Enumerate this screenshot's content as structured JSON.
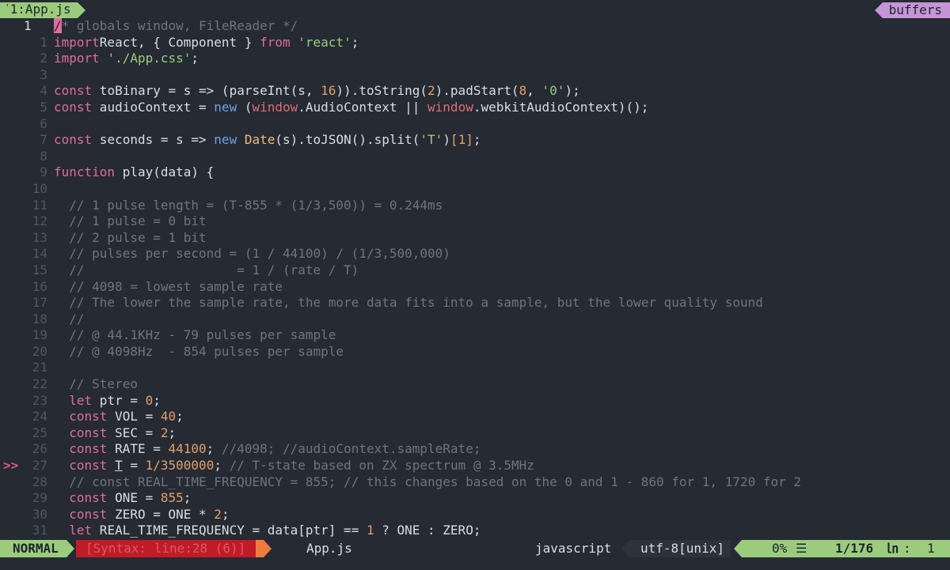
{
  "tabline": {
    "modified_mark": "'",
    "active_tab": "1:App.js",
    "buffers_label": "buffers"
  },
  "editor": {
    "lines": [
      {
        "sign": "",
        "num": "1",
        "current": true,
        "tokens": [
          [
            "cursor",
            "/"
          ],
          [
            "cmt",
            "* globals window, FileReader */"
          ]
        ]
      },
      {
        "sign": "",
        "num": "1",
        "tokens": [
          [
            "kw",
            "import"
          ],
          [
            "",
            "React, { Component } "
          ],
          [
            "kw",
            "from"
          ],
          [
            "",
            " "
          ],
          [
            "str",
            "'react'"
          ],
          [
            "",
            ";"
          ]
        ]
      },
      {
        "sign": "",
        "num": "2",
        "tokens": [
          [
            "kw",
            "import"
          ],
          [
            "",
            " "
          ],
          [
            "str",
            "'./App.css'"
          ],
          [
            "",
            ";"
          ]
        ]
      },
      {
        "sign": "",
        "num": "3",
        "tokens": []
      },
      {
        "sign": "",
        "num": "4",
        "tokens": [
          [
            "kw",
            "const"
          ],
          [
            "",
            " toBinary = s => (parseInt(s, "
          ],
          [
            "num",
            "16"
          ],
          [
            "",
            "))"
          ],
          [
            "",
            ".toString("
          ],
          [
            "num",
            "2"
          ],
          [
            "",
            ").padStart("
          ],
          [
            "num",
            "8"
          ],
          [
            "",
            ", "
          ],
          [
            "str",
            "'0'"
          ],
          [
            "",
            ");"
          ]
        ]
      },
      {
        "sign": "",
        "num": "5",
        "tokens": [
          [
            "kw",
            "const"
          ],
          [
            "",
            " audioContext = "
          ],
          [
            "blue",
            "new"
          ],
          [
            "",
            " ("
          ],
          [
            "red",
            "window"
          ],
          [
            "",
            ".AudioContext || "
          ],
          [
            "red",
            "window"
          ],
          [
            "",
            ".webkitAudioContext)();"
          ]
        ]
      },
      {
        "sign": "",
        "num": "6",
        "tokens": []
      },
      {
        "sign": "",
        "num": "7",
        "tokens": [
          [
            "kw",
            "const"
          ],
          [
            "",
            " seconds = s => "
          ],
          [
            "blue",
            "new"
          ],
          [
            "",
            " "
          ],
          [
            "yel",
            "Date"
          ],
          [
            "",
            "(s).toJSON().split("
          ],
          [
            "str",
            "'T'"
          ],
          [
            "",
            ")"
          ],
          [
            "num",
            "[1]"
          ],
          [
            "",
            ";"
          ]
        ]
      },
      {
        "sign": "",
        "num": "8",
        "tokens": []
      },
      {
        "sign": "",
        "num": "9",
        "tokens": [
          [
            "kw",
            "function"
          ],
          [
            "",
            " play(data) {"
          ]
        ]
      },
      {
        "sign": "",
        "num": "10",
        "tokens": []
      },
      {
        "sign": "",
        "num": "11",
        "tokens": [
          [
            "",
            "  "
          ],
          [
            "cmt",
            "// 1 pulse length = (T-855 * (1/3,500)) = 0.244ms"
          ]
        ]
      },
      {
        "sign": "",
        "num": "12",
        "tokens": [
          [
            "",
            "  "
          ],
          [
            "cmt",
            "// 1 pulse = 0 bit"
          ]
        ]
      },
      {
        "sign": "",
        "num": "13",
        "tokens": [
          [
            "",
            "  "
          ],
          [
            "cmt",
            "// 2 pulse = 1 bit"
          ]
        ]
      },
      {
        "sign": "",
        "num": "14",
        "tokens": [
          [
            "",
            "  "
          ],
          [
            "cmt",
            "// pulses per second = (1 / 44100) / (1/3,500,000)"
          ]
        ]
      },
      {
        "sign": "",
        "num": "15",
        "tokens": [
          [
            "",
            "  "
          ],
          [
            "cmt",
            "//                    = 1 / (rate / T)"
          ]
        ]
      },
      {
        "sign": "",
        "num": "16",
        "tokens": [
          [
            "",
            "  "
          ],
          [
            "cmt",
            "// 4098 = lowest sample rate"
          ]
        ]
      },
      {
        "sign": "",
        "num": "17",
        "tokens": [
          [
            "",
            "  "
          ],
          [
            "cmt",
            "// The lower the sample rate, the more data fits into a sample, but the lower quality sound"
          ]
        ]
      },
      {
        "sign": "",
        "num": "18",
        "tokens": [
          [
            "",
            "  "
          ],
          [
            "cmt",
            "//"
          ]
        ]
      },
      {
        "sign": "",
        "num": "19",
        "tokens": [
          [
            "",
            "  "
          ],
          [
            "cmt",
            "// @ 44.1KHz - 79 pulses per sample"
          ]
        ]
      },
      {
        "sign": "",
        "num": "20",
        "tokens": [
          [
            "",
            "  "
          ],
          [
            "cmt",
            "// @ 4098Hz  - 854 pulses per sample"
          ]
        ]
      },
      {
        "sign": "",
        "num": "21",
        "tokens": []
      },
      {
        "sign": "",
        "num": "22",
        "tokens": [
          [
            "",
            "  "
          ],
          [
            "cmt",
            "// Stereo"
          ]
        ]
      },
      {
        "sign": "",
        "num": "23",
        "tokens": [
          [
            "",
            "  "
          ],
          [
            "kw",
            "let"
          ],
          [
            "",
            " ptr = "
          ],
          [
            "num",
            "0"
          ],
          [
            "",
            ";"
          ]
        ]
      },
      {
        "sign": "",
        "num": "24",
        "tokens": [
          [
            "",
            "  "
          ],
          [
            "kw",
            "const"
          ],
          [
            "",
            " VOL = "
          ],
          [
            "num",
            "40"
          ],
          [
            "",
            ";"
          ]
        ]
      },
      {
        "sign": "",
        "num": "25",
        "tokens": [
          [
            "",
            "  "
          ],
          [
            "kw",
            "const"
          ],
          [
            "",
            " SEC = "
          ],
          [
            "num",
            "2"
          ],
          [
            "",
            ";"
          ]
        ]
      },
      {
        "sign": "",
        "num": "26",
        "tokens": [
          [
            "",
            "  "
          ],
          [
            "kw",
            "const"
          ],
          [
            "",
            " RATE = "
          ],
          [
            "num",
            "44100"
          ],
          [
            "",
            "; "
          ],
          [
            "cmt",
            "//4098; //audioContext.sampleRate;"
          ]
        ]
      },
      {
        "sign": ">>",
        "num": "27",
        "tokens": [
          [
            "",
            "  "
          ],
          [
            "kw",
            "const"
          ],
          [
            "",
            " "
          ],
          [
            "ul",
            "T"
          ],
          [
            "",
            " = "
          ],
          [
            "num",
            "1/3500000"
          ],
          [
            "",
            "; "
          ],
          [
            "cmt",
            "// T-state based on ZX spectrum @ 3.5MHz"
          ]
        ]
      },
      {
        "sign": "",
        "num": "28",
        "tokens": [
          [
            "",
            "  "
          ],
          [
            "cmt",
            "// const REAL_TIME_FREQUENCY = 855; // this changes based on the 0 and 1 - 860 for 1, 1720 for 2"
          ]
        ]
      },
      {
        "sign": "",
        "num": "29",
        "tokens": [
          [
            "",
            "  "
          ],
          [
            "kw",
            "const"
          ],
          [
            "",
            " ONE = "
          ],
          [
            "num",
            "855"
          ],
          [
            "",
            ";"
          ]
        ]
      },
      {
        "sign": "",
        "num": "30",
        "tokens": [
          [
            "",
            "  "
          ],
          [
            "kw",
            "const"
          ],
          [
            "",
            " ZERO = ONE * "
          ],
          [
            "num",
            "2"
          ],
          [
            "",
            ";"
          ]
        ]
      },
      {
        "sign": "",
        "num": "31",
        "tokens": [
          [
            "",
            "  "
          ],
          [
            "kw",
            "let"
          ],
          [
            "",
            " REAL_TIME_FREQUENCY = data[ptr] == "
          ],
          [
            "num",
            "1"
          ],
          [
            "",
            " ? ONE : ZERO;"
          ]
        ]
      }
    ]
  },
  "statusline": {
    "mode": "NORMAL",
    "syntax_msg": "[Syntax: line:28 (6)]",
    "filename": "App.js",
    "filetype": "javascript",
    "encoding": "utf-8[unix]",
    "percent": "0%",
    "percent_icon": "☰",
    "position": "1/176",
    "line_icon": "㏑",
    "col_sep": ":",
    "column": "1"
  },
  "colors": {
    "background": "#252a33",
    "accent_green": "#9bcc7d",
    "accent_purple": "#c595d6",
    "error_red": "#c01c28",
    "keyword": "#e06ca0",
    "string": "#9bcc7d",
    "number": "#e0a06a",
    "comment": "#6c7585"
  }
}
